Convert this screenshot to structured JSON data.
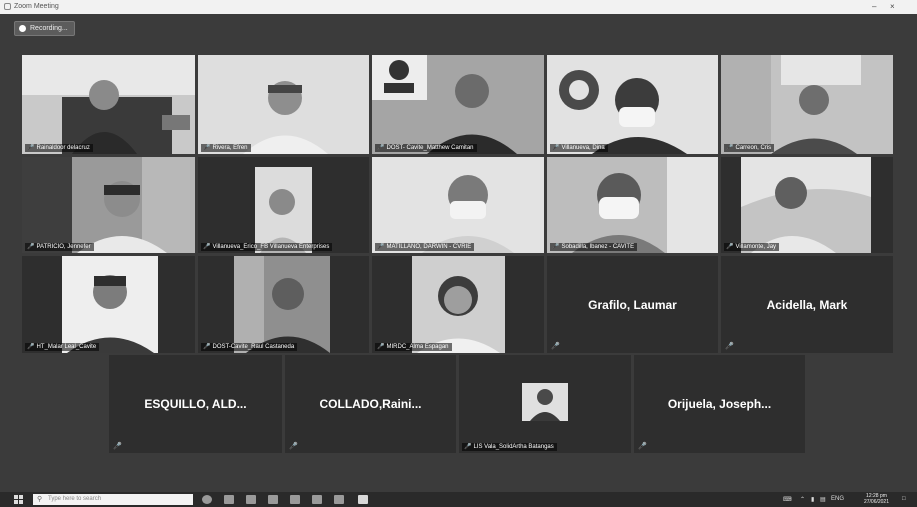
{
  "window": {
    "title": "Zoom Meeting"
  },
  "recording": {
    "label": "Recording..."
  },
  "participants": [
    {
      "name": "Rainaldoor delacruz"
    },
    {
      "name": "Rivera, Efren"
    },
    {
      "name": "DOST- Cavite_Matthew Camitan"
    },
    {
      "name": "Villanueva, Dina"
    },
    {
      "name": "Carreon, Cris"
    },
    {
      "name": "PATRICIO, Jennefer"
    },
    {
      "name": "Villanueva_Erico_FB Villanueva Enterprises"
    },
    {
      "name": "MATILLANO, DARWIN - CVRIE"
    },
    {
      "name": "Sobadilla, Ibanez - CAVITE"
    },
    {
      "name": "Villamonte, Jay"
    },
    {
      "name": "HT_Malar Leal_Cavite"
    },
    {
      "name": "DOST-Cavite_Raul Castaneda"
    },
    {
      "name": "MIRDC_Alma Espagan"
    },
    {
      "name": "Grafilo, Laumar"
    },
    {
      "name": "Acidella, Mark"
    },
    {
      "name": "ESQUILLO,  ALD..."
    },
    {
      "name": "COLLADO,Raini..."
    },
    {
      "name": "LIS Vala_SolidArtha Batangas"
    },
    {
      "name": "Orijuela,  Joseph..."
    }
  ],
  "taskbar": {
    "search_placeholder": "Type here to search",
    "lang": "ENG",
    "time": "12:28 pm",
    "date": "27/06/2021"
  },
  "colors": {
    "stage": "#3b3b3b",
    "tile": "#2e2e2e",
    "taskbar": "#2a2a2a"
  }
}
